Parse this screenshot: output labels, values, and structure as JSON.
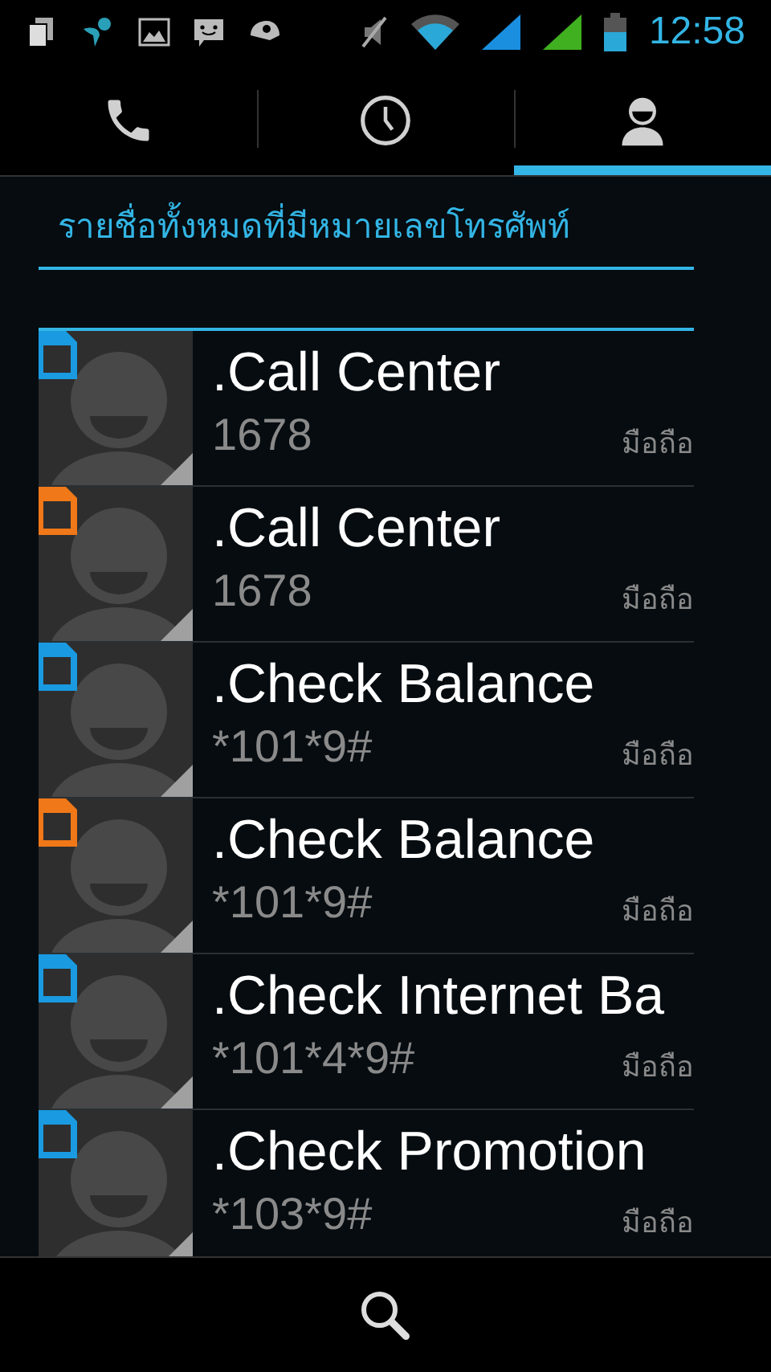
{
  "status_bar": {
    "time": "12:58"
  },
  "tabs": [
    {
      "kind": "phone",
      "selected": false
    },
    {
      "kind": "clock",
      "selected": false
    },
    {
      "kind": "person",
      "selected": true
    }
  ],
  "header": "รายชื่อทั้งหมดที่มีหมายเลขโทรศัพท์",
  "contacts": [
    {
      "name": ".Call Center",
      "number": "1678",
      "type": "มือถือ",
      "color": "#1a9ae0"
    },
    {
      "name": ".Call Center",
      "number": "1678",
      "type": "มือถือ",
      "color": "#f07818"
    },
    {
      "name": ".Check Balance",
      "number": "*101*9#",
      "type": "มือถือ",
      "color": "#1a9ae0"
    },
    {
      "name": ".Check Balance",
      "number": "*101*9#",
      "type": "มือถือ",
      "color": "#f07818"
    },
    {
      "name": ".Check Internet Ba",
      "number": "*101*4*9#",
      "type": "มือถือ",
      "color": "#1a9ae0"
    },
    {
      "name": ".Check Promotion",
      "number": "*103*9#",
      "type": "มือถือ",
      "color": "#1a9ae0"
    }
  ]
}
